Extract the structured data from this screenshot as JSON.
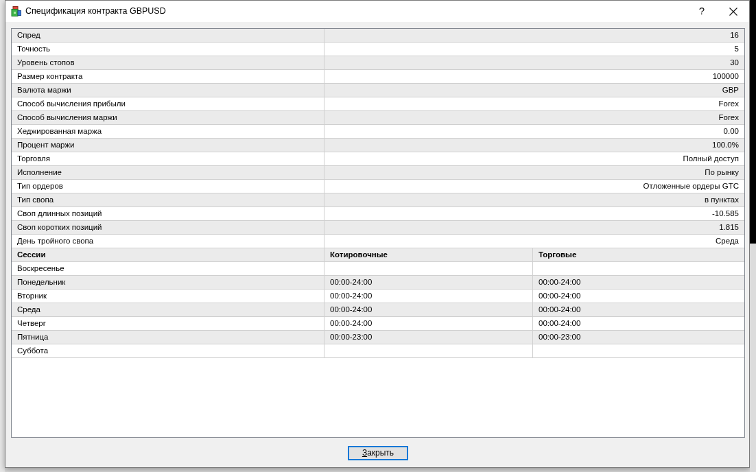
{
  "window": {
    "title": "Спецификация контракта GBPUSD",
    "help_button": "?"
  },
  "specs": [
    {
      "label": "Спред",
      "value": "16"
    },
    {
      "label": "Точность",
      "value": "5"
    },
    {
      "label": "Уровень стопов",
      "value": "30"
    },
    {
      "label": "Размер контракта",
      "value": "100000"
    },
    {
      "label": "Валюта маржи",
      "value": "GBP"
    },
    {
      "label": "Способ вычисления прибыли",
      "value": "Forex"
    },
    {
      "label": "Способ вычисления маржи",
      "value": "Forex"
    },
    {
      "label": "Хеджированная маржа",
      "value": "0.00"
    },
    {
      "label": "Процент маржи",
      "value": "100.0%"
    },
    {
      "label": "Торговля",
      "value": "Полный доступ"
    },
    {
      "label": "Исполнение",
      "value": "По рынку"
    },
    {
      "label": "Тип ордеров",
      "value": "Отложенные ордеры GTC"
    },
    {
      "label": "Тип свопа",
      "value": "в пунктах"
    },
    {
      "label": "Своп длинных позиций",
      "value": "-10.585"
    },
    {
      "label": "Своп коротких позиций",
      "value": "1.815"
    },
    {
      "label": "День тройного свопа",
      "value": "Среда"
    }
  ],
  "sessions": {
    "columns": [
      "Сессии",
      "Котировочные",
      "Торговые"
    ],
    "rows": [
      {
        "day": "Воскресенье"
      },
      {
        "day": "Понедельник",
        "quotes": "00:00-24:00",
        "trades": "00:00-24:00"
      },
      {
        "day": "Вторник",
        "quotes": "00:00-24:00",
        "trades": "00:00-24:00"
      },
      {
        "day": "Среда",
        "quotes": "00:00-24:00",
        "trades": "00:00-24:00"
      },
      {
        "day": "Четверг",
        "quotes": "00:00-24:00",
        "trades": "00:00-24:00"
      },
      {
        "day": "Пятница",
        "quotes": "00:00-23:00",
        "trades": "00:00-23:00"
      },
      {
        "day": "Суббота"
      }
    ]
  },
  "footer": {
    "close_button": {
      "label": "Закрыть",
      "focused": true
    }
  }
}
